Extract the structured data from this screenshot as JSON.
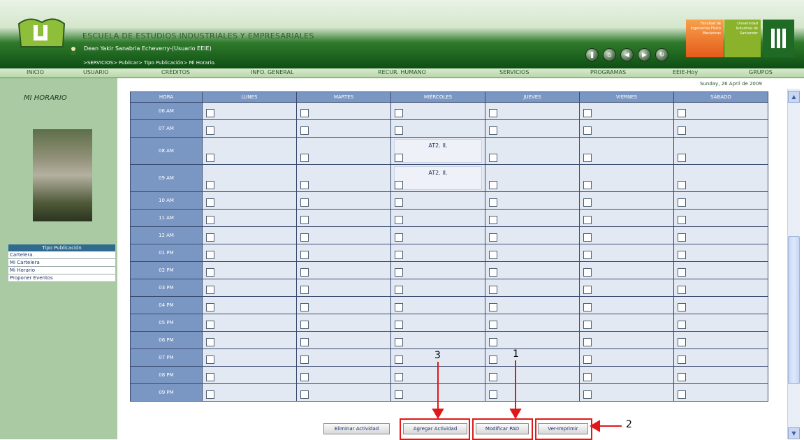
{
  "header": {
    "school": "ESCUELA DE ESTUDIOS INDUSTRIALES Y EMPRESARIALES",
    "user": "Dean Yakir Sanabria Echeverry-(Usuario EEIE)",
    "breadcrumb": ">SERVICIOS> Publicar> Tipo Publicación> Mi Horario.",
    "logo1": "Facultad de Ingenierías Físico Mecánicas",
    "logo2": "Universidad Industrial de Santander"
  },
  "menu": [
    "INICIO",
    "USUARIO",
    "CRÉDITOS",
    "INFO. GENERAL",
    "RECUR. HUMANO",
    "SERVICIOS",
    "PROGRAMAS",
    "EEIE-Hoy",
    "GRUPOS"
  ],
  "date": "Sunday, 26 April de 2009",
  "sidebar": {
    "title": "MI HORARIO",
    "pub_header": "Tipo Publicación",
    "pub_items": [
      "Cartelera.",
      "Mi Cartelera",
      "Mi Horario",
      "Proponer Eventos"
    ]
  },
  "schedule": {
    "headers": [
      "HORA",
      "LUNES",
      "MARTES",
      "MIÉRCOLES",
      "JUEVES",
      "VIERNES",
      "SÁBADO"
    ],
    "hours": [
      "06 AM",
      "07 AM",
      "08 AM",
      "09 AM",
      "10 AM",
      "11 AM",
      "12 AM",
      "01 PM",
      "02 PM",
      "03 PM",
      "04 PM",
      "05 PM",
      "06 PM",
      "07 PM",
      "08 PM",
      "09 PM"
    ],
    "activity_label": "AT2. II."
  },
  "buttons": {
    "delete": "Eliminar Actividad",
    "add": "Agregar Actividad",
    "modify": "Modificar PAD",
    "print": "Ver-Imprimir"
  },
  "annotations": {
    "one": "1",
    "two": "2",
    "three": "3"
  },
  "colors": {
    "annotation_red": "#e01818",
    "header_green": "#0e4f14",
    "grid_header": "#7a97c4"
  }
}
